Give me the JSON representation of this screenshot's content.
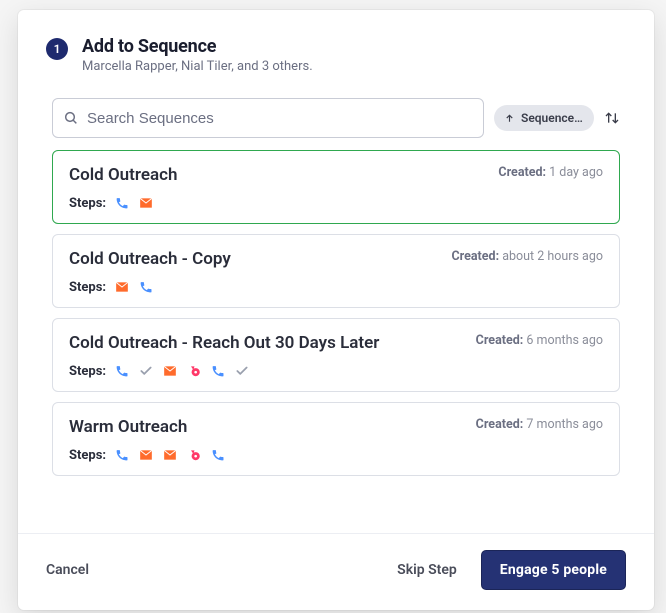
{
  "modal": {
    "step_number": "1",
    "title": "Add to Sequence",
    "subtitle": "Marcella Rapper, Nial Tiler, and 3 others."
  },
  "search": {
    "placeholder": "Search Sequences",
    "value": ""
  },
  "sort": {
    "label": "Sequence …"
  },
  "created_label": "Created:",
  "steps_label": "Steps:",
  "sequences": [
    {
      "name": "Cold Outreach",
      "created": "1 day ago",
      "selected": true,
      "steps": [
        "phone",
        "email"
      ]
    },
    {
      "name": "Cold Outreach - Copy",
      "created": "about 2 hours ago",
      "selected": false,
      "steps": [
        "email",
        "phone"
      ]
    },
    {
      "name": "Cold Outreach - Reach Out 30 Days Later",
      "created": "6 months ago",
      "selected": false,
      "steps": [
        "phone",
        "check",
        "email",
        "auto",
        "phone",
        "check"
      ]
    },
    {
      "name": "Warm Outreach",
      "created": "7 months ago",
      "selected": false,
      "steps": [
        "phone",
        "email",
        "email",
        "auto",
        "phone"
      ]
    }
  ],
  "footer": {
    "cancel": "Cancel",
    "skip": "Skip Step",
    "engage": "Engage 5 people"
  },
  "icons": {
    "phone_color": "#4a90ff",
    "email_color": "#ff6b2c",
    "check_color": "#9aa0ae",
    "auto_color": "#ff3868"
  }
}
